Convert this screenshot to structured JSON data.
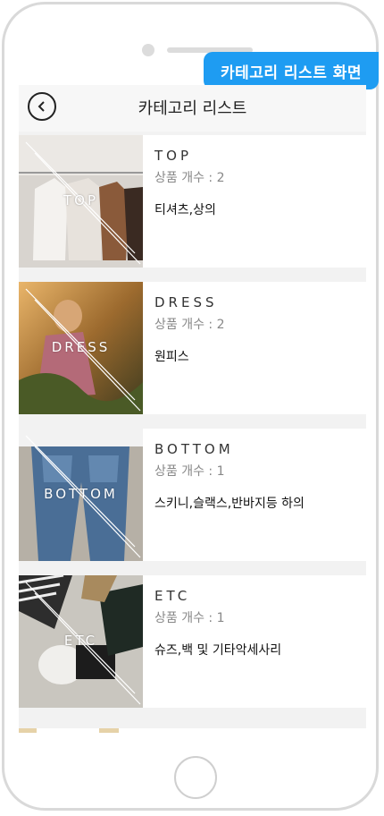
{
  "badge": "카테고리 리스트 화면",
  "header": {
    "title": "카테고리 리스트"
  },
  "categories": [
    {
      "name": "TOP",
      "thumb_label": "TOP",
      "count": "상품 개수 : 2",
      "desc": "티셔츠,상의"
    },
    {
      "name": "DRESS",
      "thumb_label": "DRESS",
      "count": "상품 개수 : 2",
      "desc": "원피스"
    },
    {
      "name": "BOTTOM",
      "thumb_label": "BOTTOM",
      "count": "상품 개수 : 1",
      "desc": "스키니,슬랙스,반바지등 하의"
    },
    {
      "name": "ETC",
      "thumb_label": "ETC",
      "count": "상품 개수 : 1",
      "desc": "슈즈,백 및 기타악세사리"
    }
  ],
  "colors": {
    "accent": "#1e9cf2"
  }
}
